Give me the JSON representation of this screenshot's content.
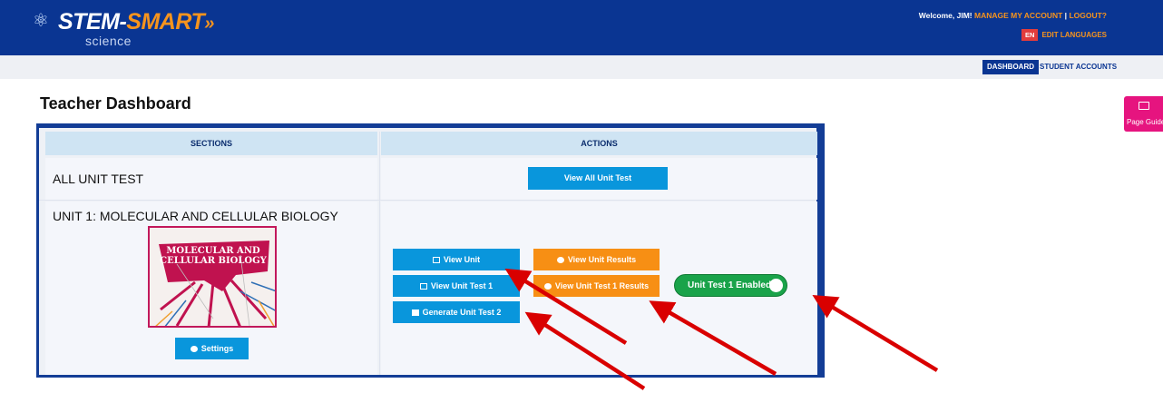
{
  "header": {
    "logo_word_1": "STEM-",
    "logo_word_2": "SMART",
    "logo_chevrons": "»",
    "logo_sub": "science",
    "welcome_prefix": "Welcome, JIM!",
    "manage_account": "MANAGE MY ACCOUNT",
    "separator": "|",
    "logout": "LOGOUT?",
    "language_code": "EN",
    "edit_languages": "EDIT LANGUAGES"
  },
  "nav": {
    "dashboard": "DASHBOARD",
    "student_accounts": "STUDENT ACCOUNTS"
  },
  "page_guide": {
    "label": "Page Guide",
    "icon": "monitor-icon"
  },
  "page_title": "Teacher Dashboard",
  "table": {
    "headers": {
      "sections": "SECTIONS",
      "actions": "ACTIONS"
    },
    "rows": [
      {
        "section": "ALL UNIT TEST",
        "actions": {
          "view_all": "View All Unit Test"
        }
      },
      {
        "section": "UNIT 1: MOLECULAR AND CELLULAR BIOLOGY",
        "image_text": "MOLECULAR AND CELLULAR BIOLOGY",
        "settings": "Settings",
        "actions": {
          "view_unit": "View Unit",
          "view_unit_test_1": "View Unit Test 1",
          "generate_unit_test_2": "Generate Unit Test 2",
          "view_unit_results": "View Unit Results",
          "view_unit_test_1_results": "View Unit Test 1 Results",
          "toggle_label": "Unit Test 1 Enabled",
          "toggle_on": true
        }
      }
    ]
  },
  "colors": {
    "brand_blue": "#0a3592",
    "button_blue": "#0996dc",
    "button_orange": "#f78f14",
    "toggle_green": "#1aa34a",
    "page_guide_pink": "#e6147f",
    "annotation_arrow": "#d90000"
  }
}
